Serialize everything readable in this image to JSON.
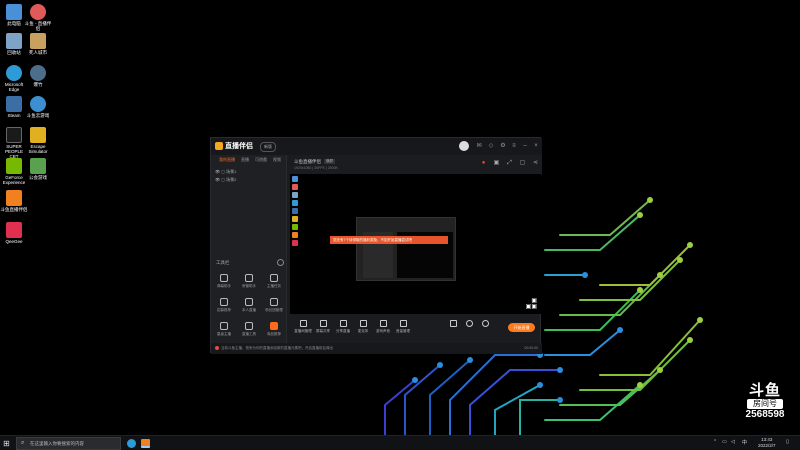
{
  "desktop": {
    "icons": [
      {
        "label": "此电脑",
        "color": "#4a90d9"
      },
      {
        "label": "斗鱼 - 直播伴侣",
        "color": "#e05a5a"
      },
      {
        "label": "回收站",
        "color": "#7fa3c7"
      },
      {
        "label": "死人城市",
        "color": "#c8a060"
      },
      {
        "label": "Microsoft Edge",
        "color": "#2e9bd6"
      },
      {
        "label": "爆竹",
        "color": "#4c6e8a"
      },
      {
        "label": "Steam",
        "color": "#3a6ea5"
      },
      {
        "label": "斗鱼云游戏",
        "color": "#3d8fd1"
      },
      {
        "label": "SUPER PEOPLE CBT",
        "color": "#1a1a1a"
      },
      {
        "label": "Escape Simulator",
        "color": "#e0b020"
      },
      {
        "label": "GeForce Experience",
        "color": "#76b900"
      },
      {
        "label": "公会游戏",
        "color": "#5aa050"
      },
      {
        "label": "斗鱼直播伴侣",
        "color": "#f08020"
      },
      {
        "label": "QeeGee",
        "color": "#e03050"
      }
    ]
  },
  "app": {
    "title": "直播伴侣",
    "version": "新版",
    "left_tabs": [
      "我的直播",
      "直播",
      "可遊戲",
      "视频"
    ],
    "scenes": [
      "场景1",
      "场景2"
    ],
    "tools_title": "工具栏",
    "tools": [
      "弹幕助手",
      "房管助手",
      "主播任务",
      "招募推荐",
      "本人直播",
      "粉丝团管理",
      "星级主播",
      "直播工具",
      "商品推荐",
      "游戏助手",
      "更多",
      "互动游戏"
    ],
    "preview": {
      "title": "斗鱼直播伴侣",
      "tag": "横屏",
      "sub": "1920x1080 | 30FPS | 2500K",
      "toast": "您还有7个待领取的福利奖励，不如开始直播尝试吧"
    },
    "controls": [
      "直播间管理",
      "屏幕共享",
      "分享直播",
      "麦克风",
      "游戏声音",
      "音量管理"
    ],
    "start_button": "开始直播",
    "status": "当前斗鱼主播，快来为你的直播添加新的直播元素吧，开启直播前会弹出",
    "status_right": "00:00:00"
  },
  "watermark": {
    "logo": "斗鱼",
    "room_label": "房间号",
    "room_number": "2568598"
  },
  "taskbar": {
    "search_placeholder": "在这里输入你要搜索的内容",
    "time": "13:43",
    "date": "2022/2/7",
    "lang": "中"
  }
}
